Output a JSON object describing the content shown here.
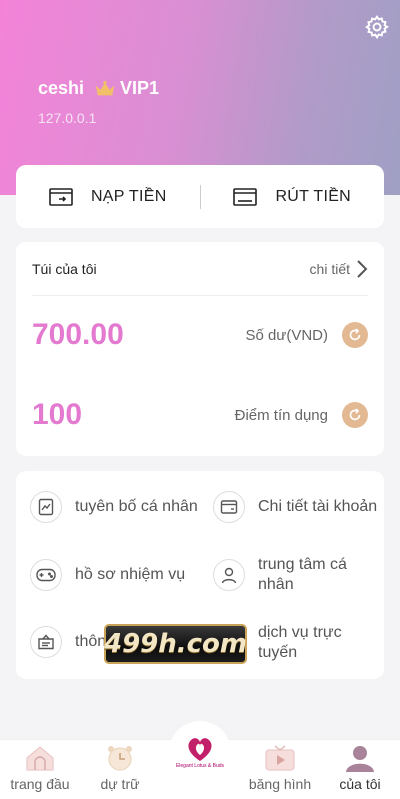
{
  "header": {
    "username": "ceshi",
    "vip_level": "VIP1",
    "ip": "127.0.0.1",
    "gradient_colors": [
      "#f483d8",
      "#9f9fc4"
    ]
  },
  "actions": {
    "deposit_label": "NẠP TIỀN",
    "withdraw_label": "RÚT TIỀN"
  },
  "wallet": {
    "title": "Túi của tôi",
    "detail_label": "chi tiết",
    "balance_value": "700.00",
    "balance_label": "Số dư(VND)",
    "credit_value": "100",
    "credit_label": "Điểm tín dụng",
    "accent_color": "#e37ad0"
  },
  "menu": {
    "items": [
      {
        "label": "tuyên bố cá nhân",
        "icon": "chart-doc-icon"
      },
      {
        "label": "Chi tiết tài khoản",
        "icon": "wallet-icon"
      },
      {
        "label": "hồ sơ nhiệm vụ",
        "icon": "gamepad-icon"
      },
      {
        "label": "trung tâm cá nhân",
        "icon": "person-icon"
      },
      {
        "label": "thôn",
        "icon": "notice-icon"
      },
      {
        "label": "dịch vụ trực tuyến",
        "icon": "chat-icon"
      }
    ]
  },
  "ad": {
    "text": "499h.com"
  },
  "tabbar": {
    "tabs": [
      {
        "label": "trang đầu",
        "icon": "home-icon"
      },
      {
        "label": "dự trữ",
        "icon": "alarm-clock-icon"
      },
      {
        "label": "băng hình",
        "icon": "tv-play-icon"
      },
      {
        "label": "của tôi",
        "icon": "user-icon"
      }
    ],
    "center_logo_text": "Elegant Lotus & Buds"
  }
}
